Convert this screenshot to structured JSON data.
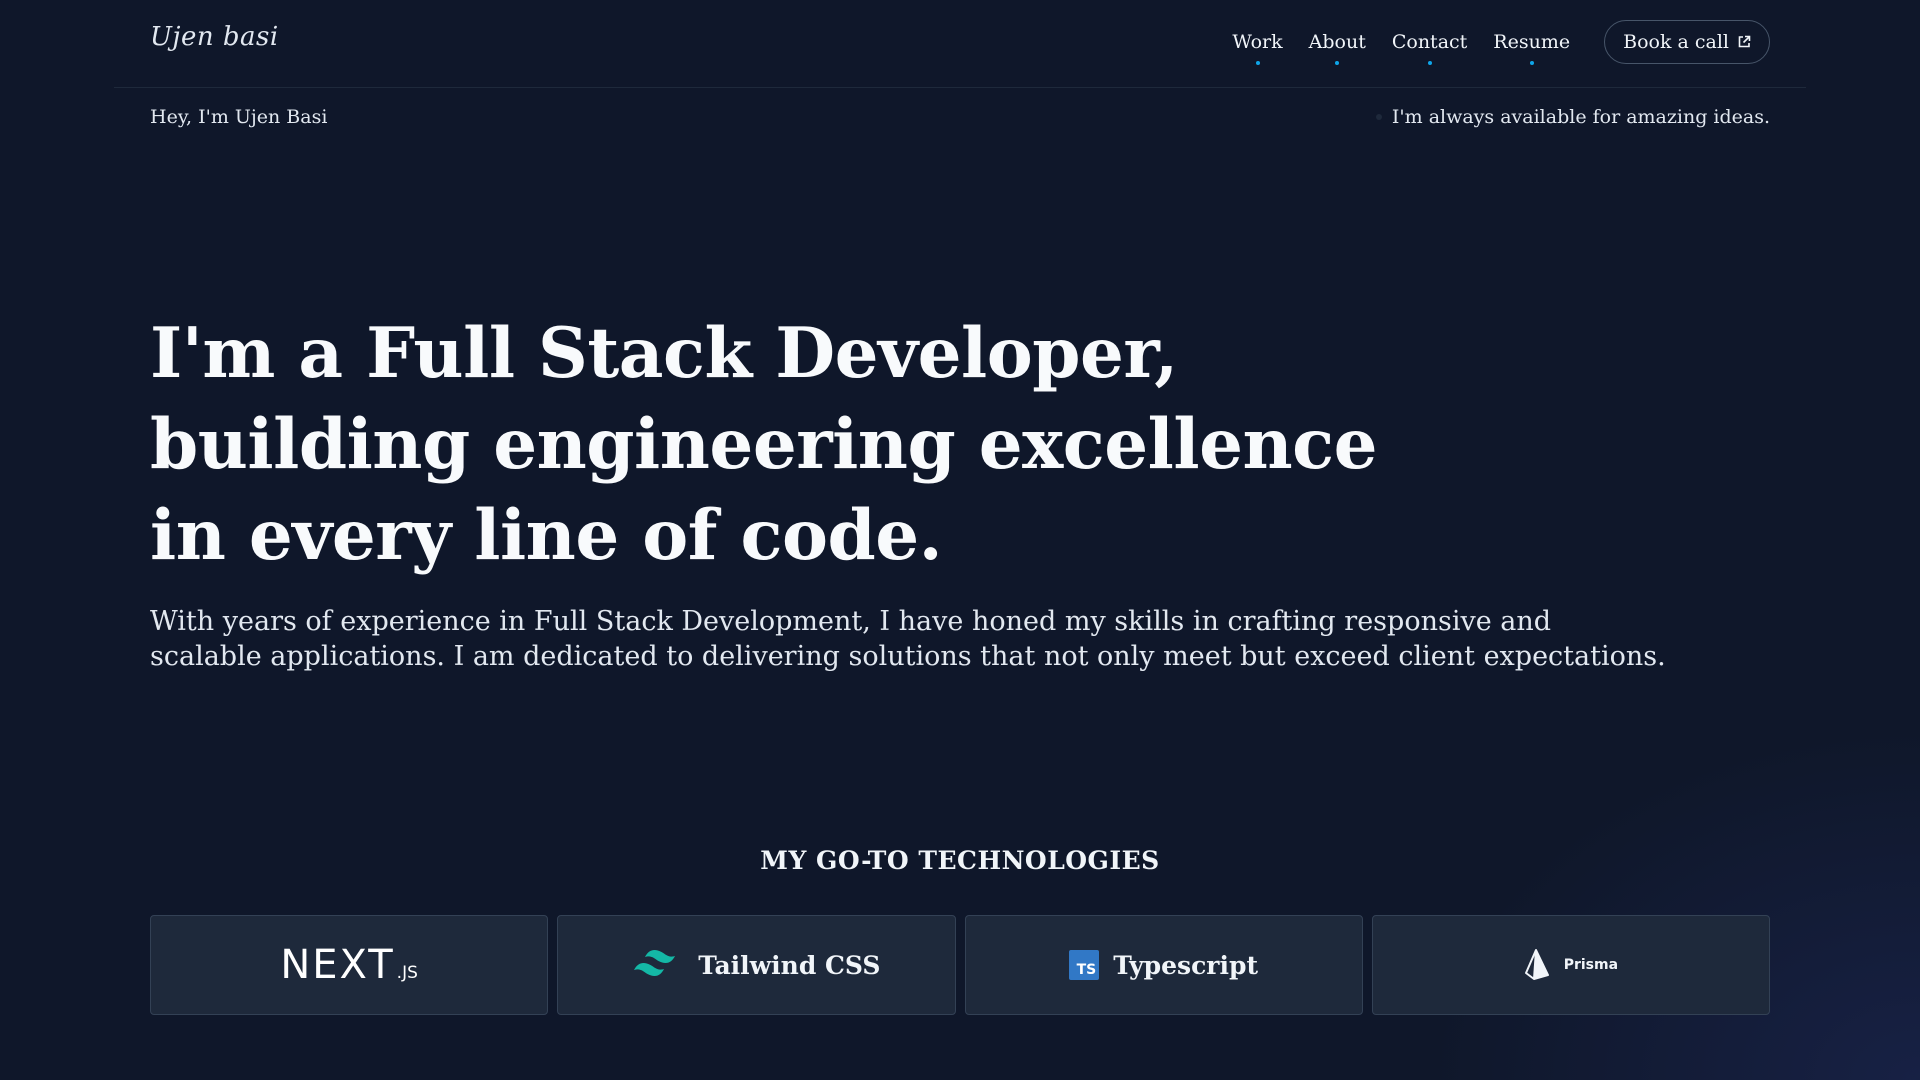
{
  "header": {
    "logo": "Ujen basi",
    "nav": [
      {
        "label": "Work"
      },
      {
        "label": "About"
      },
      {
        "label": "Contact"
      },
      {
        "label": "Resume"
      }
    ],
    "cta_label": "Book a call",
    "accent_color": "#0ea5e9"
  },
  "subheader": {
    "greeting": "Hey, I'm Ujen Basi",
    "availability": "I'm always available for amazing ideas."
  },
  "hero": {
    "title_lines": [
      "I'm a Full Stack Developer,",
      "building engineering excellence",
      "in every line of code."
    ],
    "description_lines": [
      "With years of experience in Full Stack Development, I have honed my skills in crafting responsive and",
      "scalable applications. I am dedicated to delivering solutions that not only meet but exceed client expectations."
    ]
  },
  "technologies": {
    "heading": "MY GO-TO TECHNOLOGIES",
    "items": [
      {
        "name": "NEXT",
        "suffix": ".JS",
        "icon": "nextjs-logo"
      },
      {
        "name": "Tailwind CSS",
        "icon": "tailwind-icon"
      },
      {
        "name": "Typescript",
        "icon": "typescript-icon",
        "badge": "TS"
      },
      {
        "name": "Prisma",
        "icon": "prisma-icon"
      }
    ]
  }
}
